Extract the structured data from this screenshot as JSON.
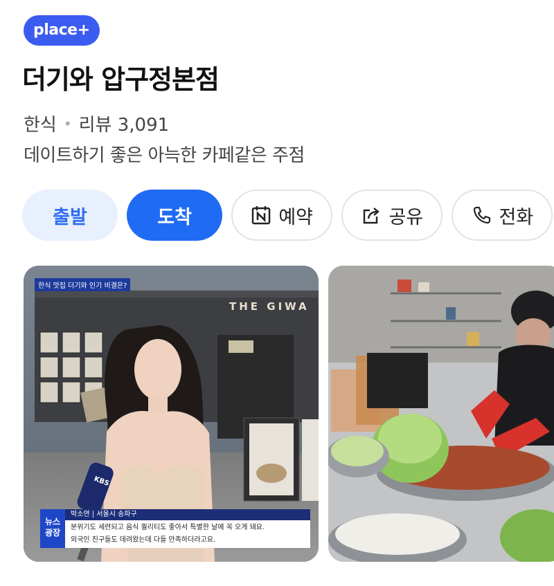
{
  "badge": {
    "label": "place+"
  },
  "place": {
    "name": "더기와 압구정본점",
    "category": "한식",
    "separator": "•",
    "reviews_label": "리뷰 3,091",
    "description": "데이트하기 좋은 아늑한 카페같은 주점"
  },
  "actions": {
    "start": "출발",
    "arrive": "도착",
    "reserve": "예약",
    "share": "공유",
    "call": "전화"
  },
  "photos": {
    "first": {
      "caption_tag": "한식 맛집 더기와 인기 비결은?",
      "store_sign": "THE GIWA",
      "news_tag_line1": "뉴스",
      "news_tag_line2": "광장",
      "interviewee": "박소연  |  서울시 송파구",
      "subtitle_line1": "분위기도 세련되고 음식 퀄리티도 좋아서 특별한 날에 꼭 오게 돼요.",
      "subtitle_line2": "외국인 친구들도 데려왔는데 다들 만족하더라고요.",
      "mic_label": "KBS"
    }
  },
  "colors": {
    "badge": "#3b5cf0",
    "primary": "#1f6bf4",
    "primary_light": "#e8f0fd"
  }
}
